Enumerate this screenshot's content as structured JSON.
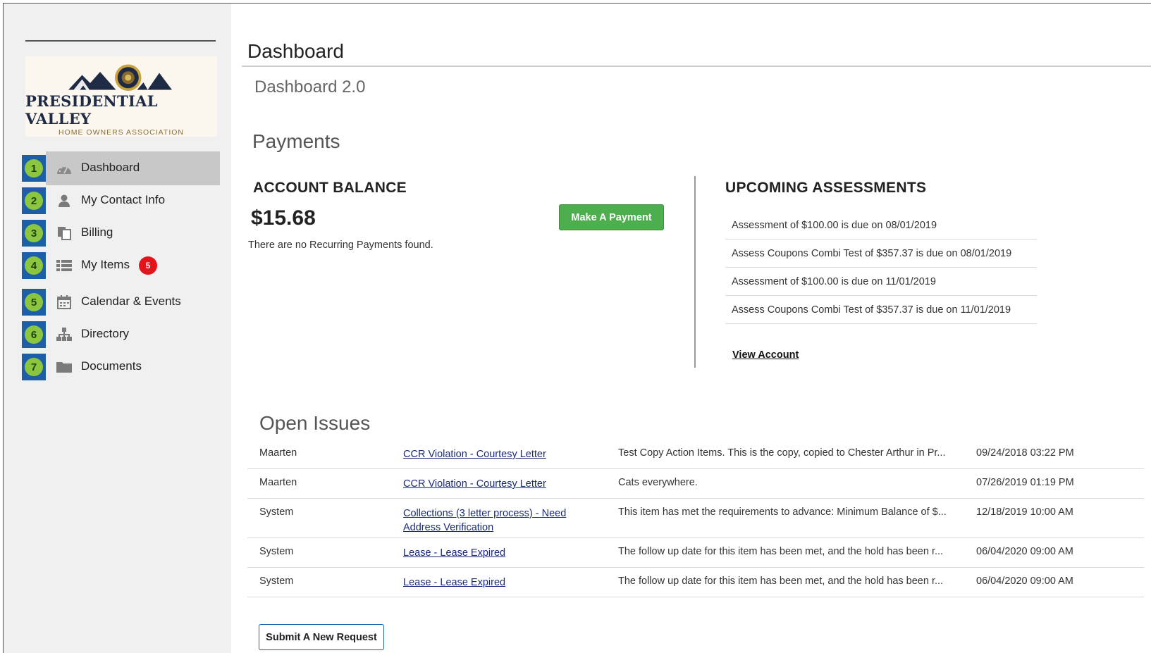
{
  "logo": {
    "title": "PRESIDENTIAL VALLEY",
    "subtitle": "HOME OWNERS ASSOCIATION"
  },
  "sidebar": {
    "items": [
      {
        "num": "1",
        "label": "Dashboard",
        "icon": "dashboard-icon",
        "active": true
      },
      {
        "num": "2",
        "label": "My Contact Info",
        "icon": "user-icon"
      },
      {
        "num": "3",
        "label": "Billing",
        "icon": "billing-icon"
      },
      {
        "num": "4",
        "label": "My Items",
        "icon": "list-icon",
        "badge": "5"
      },
      {
        "num": "5",
        "label": "Calendar & Events",
        "icon": "calendar-icon"
      },
      {
        "num": "6",
        "label": "Directory",
        "icon": "directory-icon"
      },
      {
        "num": "7",
        "label": "Documents",
        "icon": "folder-icon"
      }
    ]
  },
  "main": {
    "title": "Dashboard",
    "subtitle": "Dashboard 2.0",
    "payments_heading": "Payments",
    "account": {
      "heading": "ACCOUNT BALANCE",
      "balance": "$15.68",
      "note": "There are no Recurring Payments found.",
      "pay_button": "Make A Payment"
    },
    "upcoming": {
      "heading": "UPCOMING ASSESSMENTS",
      "items": [
        "Assessment of $100.00 is due on 08/01/2019",
        "Assess Coupons Combi Test of $357.37 is due on 08/01/2019",
        "Assessment of $100.00 is due on 11/01/2019",
        "Assess Coupons Combi Test of $357.37 is due on 11/01/2019"
      ],
      "view_account": "View Account"
    },
    "issues": {
      "heading": "Open Issues",
      "rows": [
        {
          "who": "Maarten",
          "title": "CCR Violation - Courtesy Letter",
          "desc": "Test Copy Action Items. This is the copy, copied to Chester Arthur in Pr...",
          "date": "09/24/2018 03:22 PM"
        },
        {
          "who": "Maarten",
          "title": "CCR Violation - Courtesy Letter",
          "desc": "Cats everywhere.",
          "date": "07/26/2019 01:19 PM"
        },
        {
          "who": "System",
          "title": "Collections (3 letter process) - Need Address Verification",
          "desc": "This item has met the requirements to advance: Minimum Balance of $...",
          "date": "12/18/2019 10:00 AM"
        },
        {
          "who": "System",
          "title": "Lease - Lease Expired",
          "desc": "The follow up date for this item has been met, and the hold has been r...",
          "date": "06/04/2020 09:00 AM"
        },
        {
          "who": "System",
          "title": "Lease - Lease Expired",
          "desc": "The follow up date for this item has been met, and the hold has been r...",
          "date": "06/04/2020 09:00 AM"
        }
      ],
      "submit_button": "Submit A New Request"
    }
  },
  "colors": {
    "nav_number_bg": "#1c5ea8",
    "nav_number_circle": "#8cc63f",
    "active_bg": "#c8c8c8",
    "pay_button": "#4cae4c",
    "badge": "#e3141b"
  }
}
